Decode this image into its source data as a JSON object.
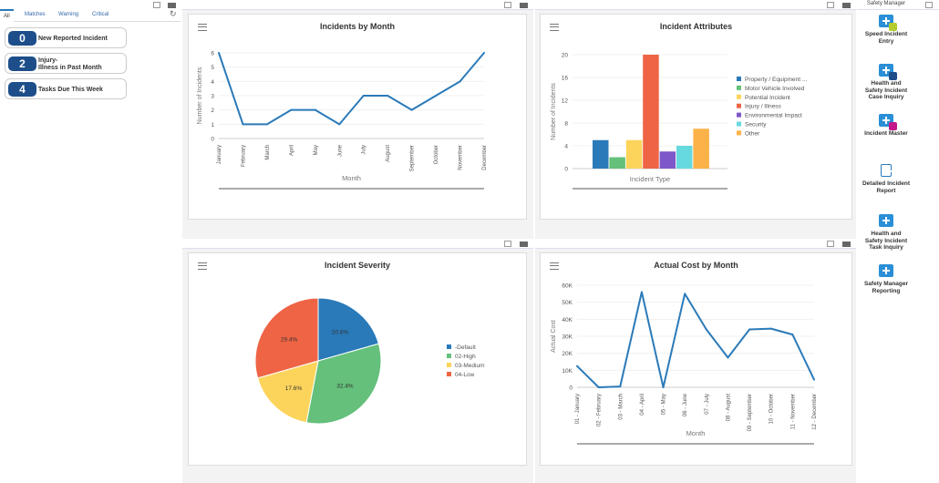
{
  "left": {
    "tabs": [
      "All",
      "Matches",
      "Warning",
      "Critical"
    ],
    "kpis": [
      {
        "value": "0",
        "label": "New Reported Incident"
      },
      {
        "value": "2",
        "label_line1": "Injury-",
        "label_line2": "Illness in Past Month"
      },
      {
        "value": "4",
        "label": "Tasks Due This Week"
      }
    ]
  },
  "right": {
    "title": "Safety Manager",
    "items": [
      {
        "line1": "Speed Incident",
        "line2": "Entry",
        "badge": "#b5cc2e"
      },
      {
        "line1": "Health and",
        "line2": "Safety Incident",
        "line3": "Case Inquiry",
        "badge": "#1d4e8a"
      },
      {
        "line1": "Incident Master",
        "badge": "#c2188c"
      },
      {
        "line1": "Detailed Incident",
        "line2": "Report"
      },
      {
        "line1": "Health and",
        "line2": "Safety Incident",
        "line3": "Task Inquiry"
      },
      {
        "line1": "Safety Manager",
        "line2": "Reporting"
      }
    ]
  },
  "chart_data": [
    {
      "type": "line",
      "title": "Incidents by Month",
      "xlabel": "Month",
      "ylabel": "Number of Incidents",
      "categories": [
        "January",
        "February",
        "March",
        "April",
        "May",
        "June",
        "July",
        "August",
        "September",
        "October",
        "November",
        "December"
      ],
      "values": [
        6,
        1,
        1,
        2,
        2,
        1,
        3,
        3,
        2,
        3,
        4,
        6
      ],
      "ylim": [
        0,
        6
      ],
      "yticks": [
        0,
        1,
        2,
        3,
        4,
        5,
        6
      ],
      "color": "#2a7ab9",
      "grid": true
    },
    {
      "type": "bar",
      "title": "Incident Attributes",
      "xlabel": "Incident Type",
      "ylabel": "Number of Incidents",
      "categories": [
        "Property / Equipment ...",
        "Motor Vehicle Involved",
        "Potential Incident",
        "Injury / Illness",
        "Environmental Impact",
        "Security",
        "Other"
      ],
      "values": [
        5,
        2,
        5,
        20,
        3,
        4,
        7
      ],
      "colors": [
        "#2a7ab9",
        "#64c07b",
        "#fcd45c",
        "#ee6445",
        "#7e57c8",
        "#66d9de",
        "#fcb248"
      ],
      "ylim": [
        0,
        20
      ],
      "yticks": [
        0,
        4,
        8,
        12,
        16,
        20
      ],
      "legend": "right",
      "grid": true
    },
    {
      "type": "pie",
      "title": "Incident Severity",
      "categories": [
        "-Default",
        "02-High",
        "03-Medium",
        "04-Low"
      ],
      "values": [
        20.6,
        32.4,
        17.6,
        29.4
      ],
      "labels": [
        "20.6%",
        "32.4%",
        "17.6%",
        "29.4%"
      ],
      "colors": [
        "#2a7ab9",
        "#64c07b",
        "#fcd45c",
        "#ee6445"
      ],
      "legend": "right"
    },
    {
      "type": "line",
      "title": "Actual Cost by Month",
      "xlabel": "Month",
      "ylabel": "Actual Cost",
      "categories": [
        "01 - January",
        "02 - February",
        "03 - March",
        "04 - April",
        "05 - May",
        "06 - June",
        "07 - July",
        "08 - August",
        "09 - September",
        "10 - October",
        "11 - November",
        "12 - December"
      ],
      "values": [
        12500,
        0,
        500,
        56000,
        0,
        55000,
        34000,
        17500,
        34000,
        34500,
        31000,
        4500
      ],
      "ylim": [
        0,
        60000
      ],
      "yticks": [
        "0",
        "10K",
        "20K",
        "30K",
        "40K",
        "50K",
        "60K"
      ],
      "color": "#2a7ab9",
      "grid": true
    }
  ]
}
